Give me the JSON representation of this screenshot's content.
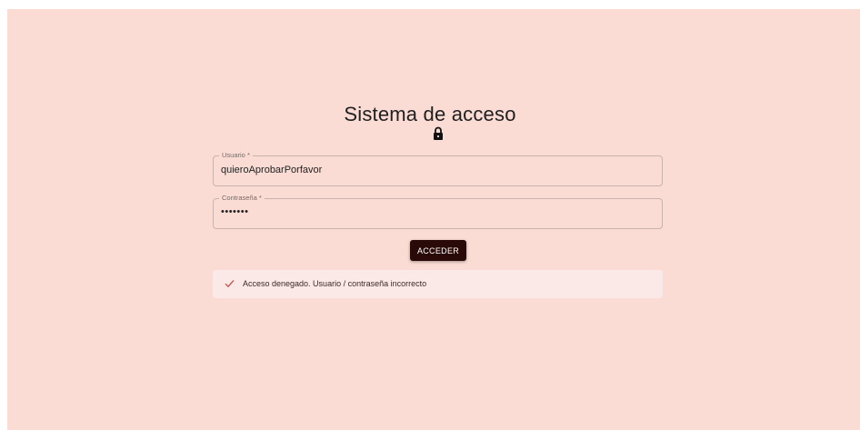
{
  "login": {
    "title": "Sistema de acceso",
    "lock_icon": "lock-icon",
    "username": {
      "label": "Usuario",
      "required_mark": "*",
      "value": "quieroAprobarPorfavor"
    },
    "password": {
      "label": "Contraseña",
      "required_mark": "*",
      "value": "•••••••"
    },
    "submit_label": "ACCEDER",
    "alert": {
      "icon": "check-icon",
      "message": "Acceso denegado. Usuario / contraseña incorrecto"
    }
  },
  "colors": {
    "background": "#fadcd4",
    "button": "#2a0a08",
    "alert_bg": "#fbe9e7",
    "alert_icon": "#c0504d"
  }
}
